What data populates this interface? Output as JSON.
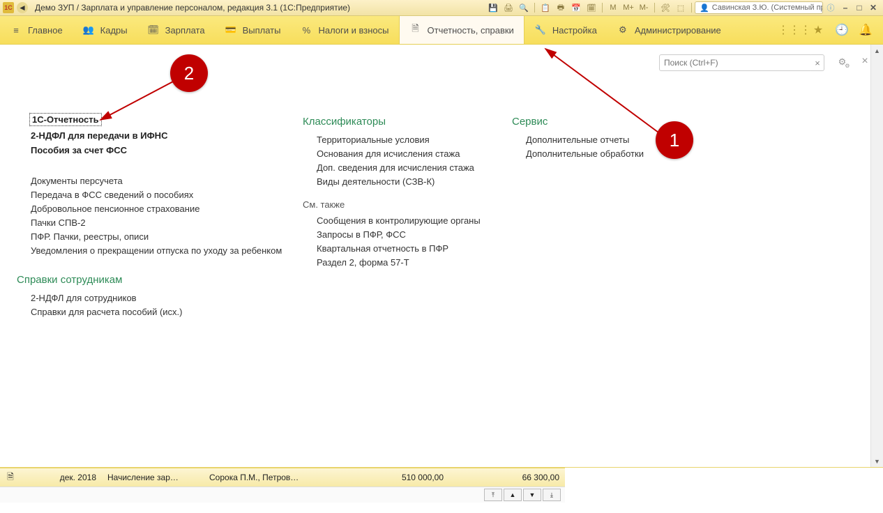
{
  "titlebar": {
    "logo_text": "1C",
    "title": "Демо ЗУП / Зарплата и управление персоналом, редакция 3.1  (1С:Предприятие)",
    "icons": [
      "💾",
      "🖨",
      "🔍",
      "📋",
      "🖶",
      "📅",
      "🗓",
      "M",
      "M+",
      "M-",
      "🛠",
      "⬚"
    ],
    "user": "Савинская З.Ю. (Системный прог…",
    "info_icon": "ⓘ",
    "minimize": "–",
    "maximize": "□",
    "close": "✕"
  },
  "nav": {
    "items": [
      {
        "label": "Главное",
        "icon": "≡"
      },
      {
        "label": "Кадры",
        "icon": "👥"
      },
      {
        "label": "Зарплата",
        "icon": "🗓"
      },
      {
        "label": "Выплаты",
        "icon": "💳"
      },
      {
        "label": "Налоги и взносы",
        "icon": "%"
      },
      {
        "label": "Отчетность, справки",
        "icon": "🗎",
        "active": true
      },
      {
        "label": "Настройка",
        "icon": "🔧"
      },
      {
        "label": "Администрирование",
        "icon": "⚙"
      }
    ],
    "right_icons": [
      "⋮⋮⋮",
      "★",
      "🕘",
      "🔔"
    ]
  },
  "search": {
    "placeholder": "Поиск (Ctrl+F)",
    "clear": "×"
  },
  "pane_close": "×",
  "col1": {
    "bold": [
      "1С-Отчетность",
      "2-НДФЛ для передачи в ИФНС",
      "Пособия за счет ФСС"
    ],
    "links": [
      "Документы персучета",
      "Передача в ФСС сведений о пособиях",
      "Добровольное пенсионное страхование",
      "Пачки СПВ-2",
      "ПФР. Пачки, реестры, описи",
      "Уведомления о прекращении отпуска по уходу за ребенком"
    ],
    "section2": "Справки сотрудникам",
    "links2": [
      "2-НДФЛ для сотрудников",
      "Справки для расчета пособий (исх.)"
    ]
  },
  "col2": {
    "section": "Классификаторы",
    "links": [
      "Территориальные условия",
      "Основания для исчисления стажа",
      "Доп. сведения для исчисления стажа",
      "Виды деятельности (СЗВ-К)"
    ],
    "section2": "См. также",
    "links2": [
      "Сообщения в контролирующие органы",
      "Запросы в ПФР, ФСС",
      "Квартальная отчетность в ПФР",
      "Раздел 2, форма 57-Т"
    ]
  },
  "col3": {
    "section": "Сервис",
    "links": [
      "Дополнительные отчеты",
      "Дополнительные обработки"
    ]
  },
  "callouts": {
    "one": "1",
    "two": "2"
  },
  "bottom": {
    "date": "дек. 2018",
    "doc": "Начисление зар…",
    "person": "Сорока П.М., Петров…",
    "sum1": "510 000,00",
    "sum2": "66 300,00",
    "nav": [
      "⤒",
      "▲",
      "▼",
      "⤓"
    ]
  }
}
